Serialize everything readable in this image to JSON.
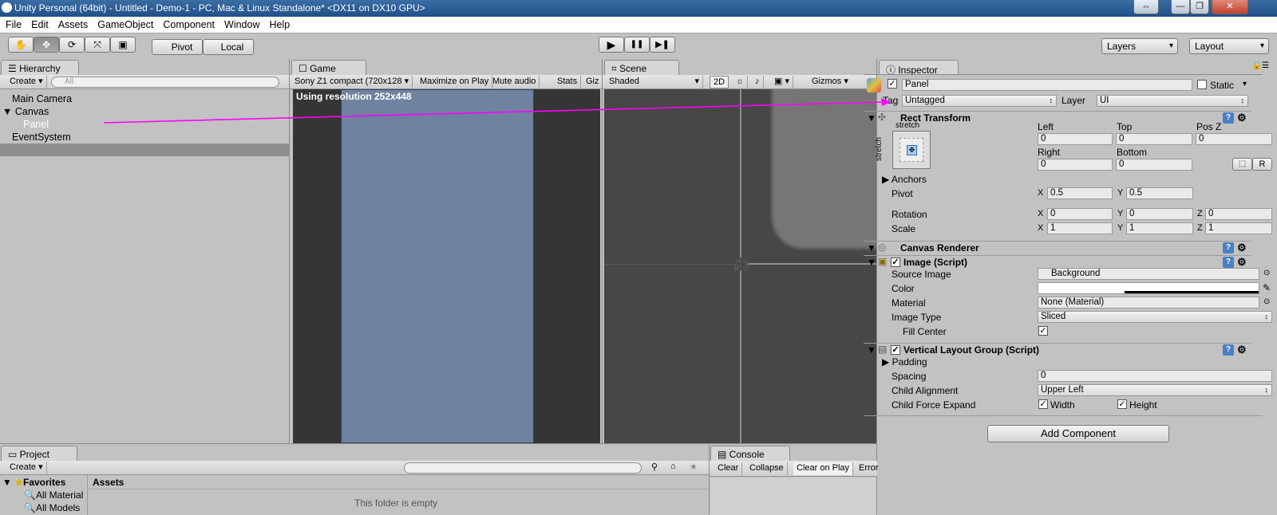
{
  "window": {
    "title": "Unity Personal (64bit) - Untitled - Demo-1 - PC, Mac & Linux Standalone* <DX11 on DX10 GPU>",
    "btn_restore": "⇔",
    "btn_min": "—",
    "btn_max": "❐",
    "btn_close": "✕"
  },
  "menu": [
    "File",
    "Edit",
    "Assets",
    "GameObject",
    "Component",
    "Window",
    "Help"
  ],
  "toolbar": {
    "pivot": "Pivot",
    "local": "Local",
    "play": "▶",
    "pause": "❚❚",
    "step": "▶❚",
    "layers": "Layers",
    "layout": "Layout",
    "tools": [
      "hand-icon",
      "move-icon",
      "rotate-icon",
      "scale-icon",
      "rect-icon"
    ]
  },
  "hierarchy": {
    "tab": "Hierarchy",
    "create": "Create",
    "search_placeholder": "All",
    "items": [
      "Main Camera",
      "Canvas",
      "Panel",
      "EventSystem"
    ]
  },
  "game": {
    "tab": "Game",
    "aspect": "Sony Z1 compact (720x128",
    "maximize": "Maximize on Play",
    "mute": "Mute audio",
    "stats": "Stats",
    "gizmos": "Giz",
    "resolution": "Using resolution 252x448"
  },
  "scene": {
    "tab": "Scene",
    "shading": "Shaded",
    "mode2d": "2D",
    "gizmos": "Gizmos"
  },
  "inspector": {
    "tab": "Inspector",
    "object_name": "Panel",
    "static": "Static",
    "tag_label": "Tag",
    "tag_value": "Untagged",
    "layer_label": "Layer",
    "layer_value": "UI",
    "rect": {
      "title": "Rect Transform",
      "anchor_top": "stretch",
      "anchor_side": "stretch",
      "left_label": "Left",
      "left": "0",
      "top_label": "Top",
      "top": "0",
      "posz_label": "Pos Z",
      "posz": "0",
      "right_label": "Right",
      "right": "0",
      "bottom_label": "Bottom",
      "bottom": "0",
      "r_btn": "R",
      "anchors": "Anchors",
      "pivot_label": "Pivot",
      "pivot_x": "0.5",
      "pivot_y": "0.5",
      "rotation_label": "Rotation",
      "rot_x": "0",
      "rot_y": "0",
      "rot_z": "0",
      "scale_label": "Scale",
      "scale_x": "1",
      "scale_y": "1",
      "scale_z": "1",
      "x": "X",
      "y": "Y",
      "z": "Z"
    },
    "canvas_renderer": "Canvas Renderer",
    "image": {
      "title": "Image (Script)",
      "source_label": "Source Image",
      "source": "Background",
      "color_label": "Color",
      "material_label": "Material",
      "material": "None (Material)",
      "type_label": "Image Type",
      "type": "Sliced",
      "fill_label": "Fill Center"
    },
    "vlg": {
      "title": "Vertical Layout Group (Script)",
      "padding": "Padding",
      "spacing_label": "Spacing",
      "spacing": "0",
      "align_label": "Child Alignment",
      "align": "Upper Left",
      "expand_label": "Child Force Expand",
      "width": "Width",
      "height": "Height"
    },
    "add_component": "Add Component"
  },
  "project": {
    "tab": "Project",
    "create": "Create",
    "favorites": "Favorites",
    "fav_items": [
      "All Material",
      "All Models"
    ],
    "assets": "Assets",
    "empty": "This folder is empty"
  },
  "console": {
    "tab": "Console",
    "clear": "Clear",
    "collapse": "Collapse",
    "clear_on_play": "Clear on Play",
    "error": "Error"
  },
  "colors": {
    "accent_arrow": "#ff00ff",
    "selection": "#8f8f8f",
    "panel_blue": "#6f82a0"
  }
}
